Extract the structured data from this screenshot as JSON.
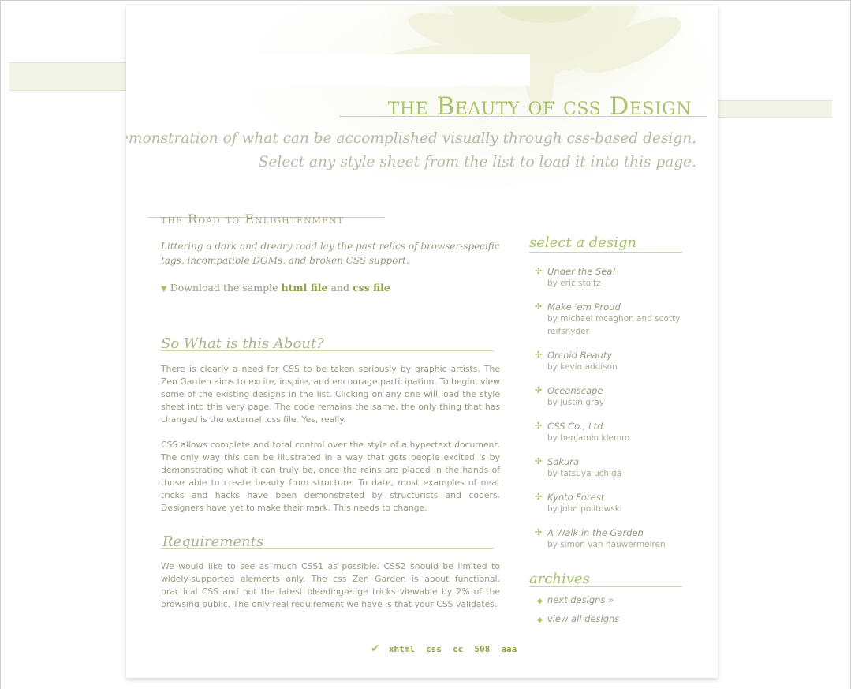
{
  "header": {
    "title": "the Beauty of css Design",
    "tagline_line1": "A demonstration of what can be accomplished visually through css-based design.",
    "tagline_line2": "Select any style sheet from the list to load it into this page."
  },
  "intro": {
    "heading": "the Road to Enlightenment",
    "text": "Littering a dark and dreary road lay the past relics of browser-specific tags, incompatible DOMs, and broken CSS support.",
    "download_prefix": "Download the sample",
    "html_link": "html file",
    "and": "and",
    "css_link": "css file"
  },
  "sections": {
    "about_heading": "So What is this About?",
    "about_p1": "There is clearly a need for CSS to be taken seriously by graphic artists. The Zen Garden aims to excite, inspire, and encourage participation. To begin, view some of the existing designs in the list. Clicking on any one will load the style sheet into this very page. The code remains the same, the only thing that has changed is the external .css file. Yes, really.",
    "about_p2": "CSS allows complete and total control over the style of a hypertext document. The only way this can be illustrated in a way that gets people excited is by demonstrating what it can truly be, once the reins are placed in the hands of those able to create beauty from structure. To date, most examples of neat tricks and hacks have been demonstrated by structurists and coders. Designers have yet to make their mark. This needs to change.",
    "req_heading": "Requirements",
    "req_p1": "We would like to see as much CSS1 as possible. CSS2 should be limited to widely-supported elements only. The css Zen Garden is about functional, practical CSS and not the latest bleeding-edge tricks viewable by 2% of the browsing public. The only real requirement we have is that your CSS validates."
  },
  "footer": {
    "links": [
      "xhtml",
      "css",
      "cc",
      "508",
      "aaa"
    ]
  },
  "sidebar": {
    "select_heading": "select a design",
    "designs": [
      {
        "name": "Under the Sea!",
        "author": "by eric stoltz"
      },
      {
        "name": "Make 'em Proud",
        "author": "by michael mcaghon and scotty reifsnyder"
      },
      {
        "name": "Orchid Beauty",
        "author": "by kevin addison"
      },
      {
        "name": "Oceanscape",
        "author": "by justin gray"
      },
      {
        "name": "CSS Co., Ltd.",
        "author": "by benjamin klemm"
      },
      {
        "name": "Sakura",
        "author": "by tatsuya uchida"
      },
      {
        "name": "Kyoto Forest",
        "author": "by john politowski"
      },
      {
        "name": "A Walk in the Garden",
        "author": "by simon van hauwermeiren"
      }
    ],
    "archives_heading": "archives",
    "archives": [
      "next designs »",
      "view all designs"
    ]
  },
  "colors": {
    "accent_green": "#a8c26a",
    "text_muted": "#9a9780",
    "band": "#f3f4e8"
  },
  "icons": {
    "bullet": "cross-bullet-icon",
    "download": "down-arrow-icon",
    "footer": "check-icon"
  }
}
